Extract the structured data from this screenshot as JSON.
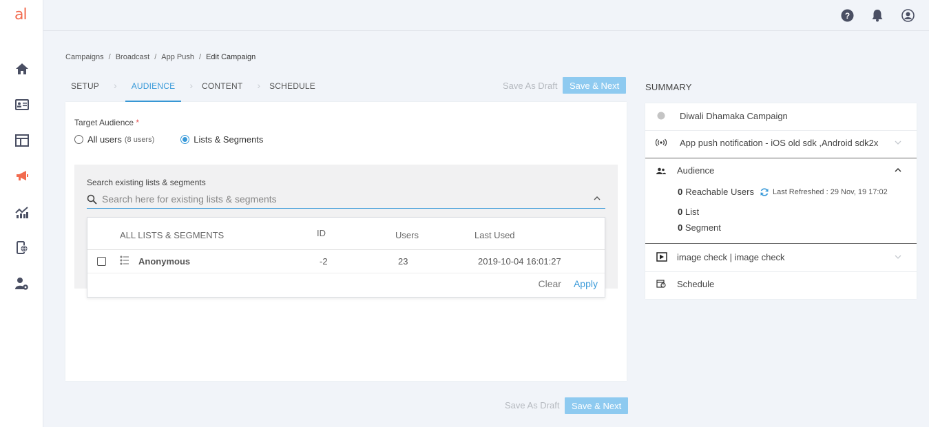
{
  "app": {
    "logo_text": "al"
  },
  "sidebar": {
    "items": [
      {
        "icon": "home-icon"
      },
      {
        "icon": "contact-card-icon"
      },
      {
        "icon": "layout-icon"
      },
      {
        "icon": "megaphone-icon"
      },
      {
        "icon": "analytics-icon"
      },
      {
        "icon": "mobile-globe-icon"
      },
      {
        "icon": "user-settings-icon"
      }
    ]
  },
  "topbar": {
    "icons": [
      "help-icon",
      "bell-icon",
      "user-icon"
    ]
  },
  "breadcrumb": {
    "items": [
      "Campaigns",
      "Broadcast",
      "App Push",
      "Edit Campaign"
    ]
  },
  "steps": {
    "items": [
      "SETUP",
      "AUDIENCE",
      "CONTENT",
      "SCHEDULE"
    ],
    "active": "AUDIENCE"
  },
  "actions": {
    "save_draft": "Save As Draft",
    "save_next": "Save & Next"
  },
  "audience": {
    "label": "Target Audience",
    "required_mark": "*",
    "options": {
      "all_users": "All users",
      "all_users_count": "(8 users)",
      "lists_segments": "Lists & Segments"
    },
    "selected": "lists_segments"
  },
  "search": {
    "label": "Search existing lists & segments",
    "placeholder": "Search here for existing lists & segments",
    "value": ""
  },
  "dropdown": {
    "columns": [
      "ALL LISTS & SEGMENTS",
      "ID",
      "Users",
      "Last Used"
    ],
    "rows": [
      {
        "name": "Anonymous",
        "id": "-2",
        "users": "23",
        "last_used": "2019-10-04 16:01:27"
      }
    ],
    "clear": "Clear",
    "apply": "Apply"
  },
  "summary": {
    "title": "SUMMARY",
    "campaign_name": "Diwali Dhamaka Campaign",
    "channel": "App push notification - iOS old sdk ,Android sdk2x",
    "audience_heading": "Audience",
    "reachable_count": "0",
    "reachable_label": "Reachable Users",
    "last_refreshed": "Last Refreshed : 29 Nov, 19 17:02",
    "list_count": "0",
    "list_label": "List",
    "segment_count": "0",
    "segment_label": "Segment",
    "content": "image check | image check",
    "schedule": "Schedule"
  },
  "colors": {
    "accent": "#3a9ad9",
    "brand": "#f26b4f",
    "button": "#8ecaf0"
  }
}
